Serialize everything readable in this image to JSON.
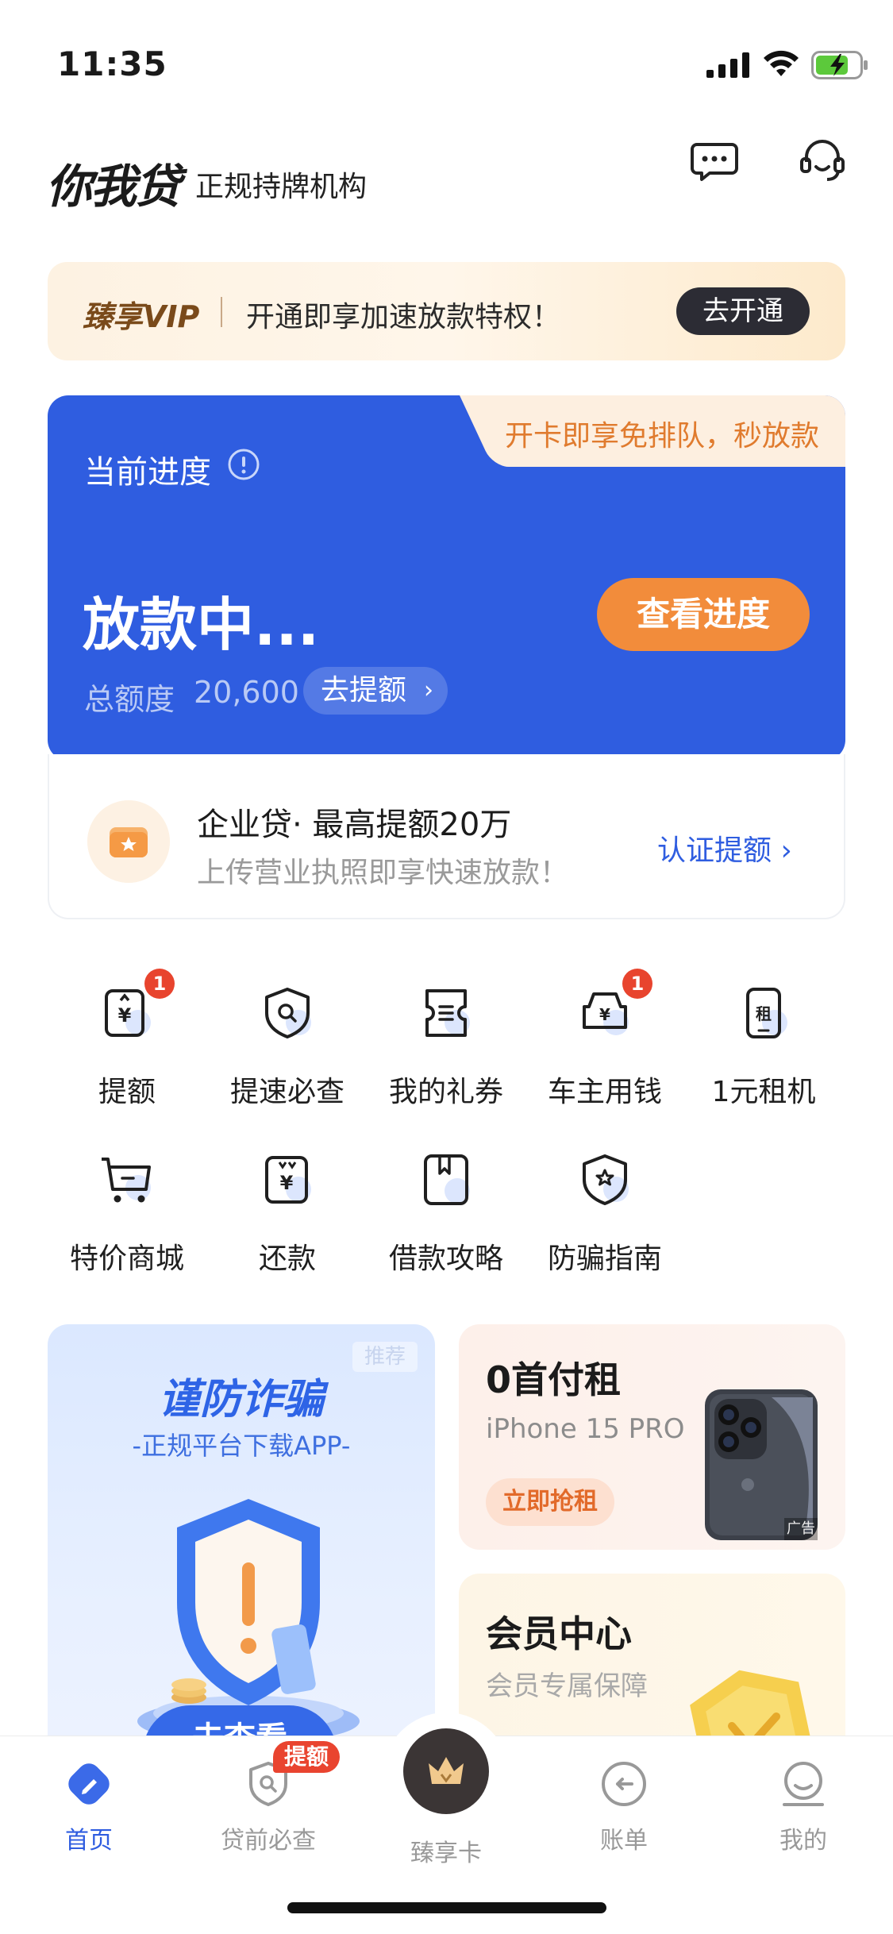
{
  "status_bar": {
    "time": "11:35"
  },
  "header": {
    "logo": "你我贷",
    "tagline": "正规持牌机构"
  },
  "vip_banner": {
    "brand": "臻享VIP",
    "text": "开通即享加速放款特权！",
    "button": "去开通"
  },
  "progress_card": {
    "tab_text": "开卡即享免排队，秒放款",
    "label": "当前进度",
    "status": "放款中...",
    "amount_label": "总额度",
    "amount_value": "20,600",
    "raise_button": "去提额",
    "view_button": "查看进度"
  },
  "enterprise_loan": {
    "title": "企业贷· 最高提额20万",
    "subtitle": "上传营业执照即享快速放款！",
    "link": "认证提额"
  },
  "grid": {
    "items": [
      {
        "label": "提额",
        "icon": "raise-limit-icon",
        "badge": "1"
      },
      {
        "label": "提速必查",
        "icon": "shield-search-icon"
      },
      {
        "label": "我的礼券",
        "icon": "coupon-icon"
      },
      {
        "label": "车主用钱",
        "icon": "car-loan-icon",
        "badge": "1"
      },
      {
        "label": "1元租机",
        "icon": "phone-rent-icon"
      },
      {
        "label": "特价商城",
        "icon": "cart-icon"
      },
      {
        "label": "还款",
        "icon": "repay-icon"
      },
      {
        "label": "借款攻略",
        "icon": "guide-book-icon"
      },
      {
        "label": "防骗指南",
        "icon": "anti-fraud-icon"
      }
    ]
  },
  "promo_fraud": {
    "tag": "推荐",
    "title": "谨防诈骗",
    "subtitle": "-正规平台下载APP-",
    "button": "去查看"
  },
  "promo_rent": {
    "title": "0首付租",
    "subtitle": "iPhone 15 PRO",
    "button": "立即抢租",
    "ad_tag": "广告"
  },
  "promo_member": {
    "title": "会员中心",
    "subtitle": "会员专属保障"
  },
  "tab_bar": {
    "tabs": [
      {
        "label": "首页"
      },
      {
        "label": "贷前必查",
        "badge": "提额"
      },
      {
        "label": "臻享卡"
      },
      {
        "label": "账单"
      },
      {
        "label": "我的"
      }
    ]
  },
  "colors": {
    "primary": "#2f5de0",
    "accent_orange": "#f28c3b",
    "badge_red": "#e9442f"
  }
}
